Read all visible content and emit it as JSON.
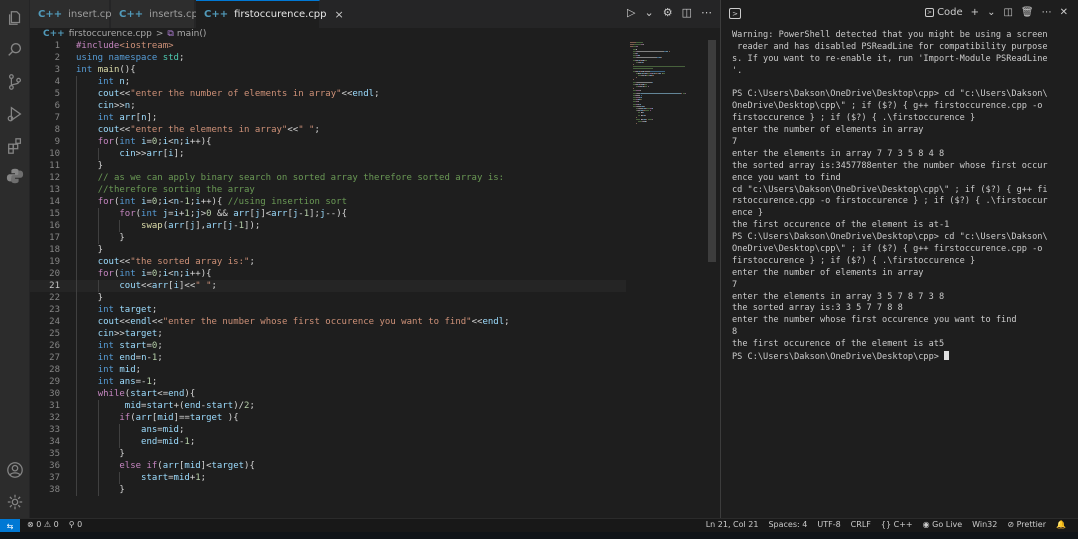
{
  "tabs": [
    {
      "label": "insert.cpp",
      "icon": "C++"
    },
    {
      "label": "inserts.cpp",
      "icon": "C++"
    },
    {
      "label": "firstoccurence.cpp",
      "icon": "C++",
      "active": true,
      "close": "×"
    }
  ],
  "breadcrumb": {
    "file": "firstoccurence.cpp",
    "separator": ">",
    "symbol": "main()"
  },
  "editor": {
    "current_line": 21,
    "lines": [
      [
        [
          "pp",
          "#include"
        ],
        [
          "st",
          "<iostream>"
        ]
      ],
      [
        [
          "kw",
          "using "
        ],
        [
          "kw",
          "namespace "
        ],
        [
          "ns",
          "std"
        ],
        [
          "op",
          ";"
        ]
      ],
      [
        [
          "kw",
          "int "
        ],
        [
          "fn",
          "main"
        ],
        [
          "op",
          "(){"
        ]
      ],
      [
        [
          "op",
          "    "
        ],
        [
          "kw",
          "int "
        ],
        [
          "vr",
          "n"
        ],
        [
          "op",
          ";"
        ]
      ],
      [
        [
          "op",
          "    "
        ],
        [
          "vr",
          "cout"
        ],
        [
          "op",
          "<<"
        ],
        [
          "st",
          "\"enter the number of elements in array\""
        ],
        [
          "op",
          "<<"
        ],
        [
          "vr",
          "endl"
        ],
        [
          "op",
          ";"
        ]
      ],
      [
        [
          "op",
          "    "
        ],
        [
          "vr",
          "cin"
        ],
        [
          "op",
          ">>"
        ],
        [
          "vr",
          "n"
        ],
        [
          "op",
          ";"
        ]
      ],
      [
        [
          "op",
          "    "
        ],
        [
          "kw",
          "int "
        ],
        [
          "vr",
          "arr"
        ],
        [
          "op",
          "["
        ],
        [
          "vr",
          "n"
        ],
        [
          "op",
          "];"
        ]
      ],
      [
        [
          "op",
          "    "
        ],
        [
          "vr",
          "cout"
        ],
        [
          "op",
          "<<"
        ],
        [
          "st",
          "\"enter the elements in array\""
        ],
        [
          "op",
          "<<"
        ],
        [
          "st",
          "\" \""
        ],
        [
          "op",
          ";"
        ]
      ],
      [
        [
          "op",
          "    "
        ],
        [
          "kc",
          "for"
        ],
        [
          "op",
          "("
        ],
        [
          "kw",
          "int "
        ],
        [
          "vr",
          "i"
        ],
        [
          "op",
          "="
        ],
        [
          "nm",
          "0"
        ],
        [
          "op",
          ";"
        ],
        [
          "vr",
          "i"
        ],
        [
          "op",
          "<"
        ],
        [
          "vr",
          "n"
        ],
        [
          "op",
          ";"
        ],
        [
          "vr",
          "i"
        ],
        [
          "op",
          "++){"
        ]
      ],
      [
        [
          "op",
          "        "
        ],
        [
          "vr",
          "cin"
        ],
        [
          "op",
          ">>"
        ],
        [
          "vr",
          "arr"
        ],
        [
          "op",
          "["
        ],
        [
          "vr",
          "i"
        ],
        [
          "op",
          "];"
        ]
      ],
      [
        [
          "op",
          "    }"
        ]
      ],
      [
        [
          "op",
          "    "
        ],
        [
          "cm",
          "// as we can apply binary search on sorted array therefore sorted array is:"
        ]
      ],
      [
        [
          "op",
          "    "
        ],
        [
          "cm",
          "//therefore sorting the array"
        ]
      ],
      [
        [
          "op",
          "    "
        ],
        [
          "kc",
          "for"
        ],
        [
          "op",
          "("
        ],
        [
          "kw",
          "int "
        ],
        [
          "vr",
          "i"
        ],
        [
          "op",
          "="
        ],
        [
          "nm",
          "0"
        ],
        [
          "op",
          ";"
        ],
        [
          "vr",
          "i"
        ],
        [
          "op",
          "<"
        ],
        [
          "vr",
          "n"
        ],
        [
          "op",
          "-"
        ],
        [
          "nm",
          "1"
        ],
        [
          "op",
          ";"
        ],
        [
          "vr",
          "i"
        ],
        [
          "op",
          "++){ "
        ],
        [
          "cm",
          "//using insertion sort"
        ]
      ],
      [
        [
          "op",
          "        "
        ],
        [
          "kc",
          "for"
        ],
        [
          "op",
          "("
        ],
        [
          "kw",
          "int "
        ],
        [
          "vr",
          "j"
        ],
        [
          "op",
          "="
        ],
        [
          "vr",
          "i"
        ],
        [
          "op",
          "+"
        ],
        [
          "nm",
          "1"
        ],
        [
          "op",
          ";"
        ],
        [
          "vr",
          "j"
        ],
        [
          "op",
          ">"
        ],
        [
          "nm",
          "0"
        ],
        [
          "op",
          " && "
        ],
        [
          "vr",
          "arr"
        ],
        [
          "op",
          "["
        ],
        [
          "vr",
          "j"
        ],
        [
          "op",
          "]<"
        ],
        [
          "vr",
          "arr"
        ],
        [
          "op",
          "["
        ],
        [
          "vr",
          "j"
        ],
        [
          "op",
          "-"
        ],
        [
          "nm",
          "1"
        ],
        [
          "op",
          "];"
        ],
        [
          "vr",
          "j"
        ],
        [
          "op",
          "--){"
        ]
      ],
      [
        [
          "op",
          "            "
        ],
        [
          "fn",
          "swap"
        ],
        [
          "op",
          "("
        ],
        [
          "vr",
          "arr"
        ],
        [
          "op",
          "["
        ],
        [
          "vr",
          "j"
        ],
        [
          "op",
          "],"
        ],
        [
          "vr",
          "arr"
        ],
        [
          "op",
          "["
        ],
        [
          "vr",
          "j"
        ],
        [
          "op",
          "-"
        ],
        [
          "nm",
          "1"
        ],
        [
          "op",
          "]);"
        ]
      ],
      [
        [
          "op",
          "        }"
        ]
      ],
      [
        [
          "op",
          "    }"
        ]
      ],
      [
        [
          "op",
          "    "
        ],
        [
          "vr",
          "cout"
        ],
        [
          "op",
          "<<"
        ],
        [
          "st",
          "\"the sorted array is:\""
        ],
        [
          "op",
          ";"
        ]
      ],
      [
        [
          "op",
          "    "
        ],
        [
          "kc",
          "for"
        ],
        [
          "op",
          "("
        ],
        [
          "kw",
          "int "
        ],
        [
          "vr",
          "i"
        ],
        [
          "op",
          "="
        ],
        [
          "nm",
          "0"
        ],
        [
          "op",
          ";"
        ],
        [
          "vr",
          "i"
        ],
        [
          "op",
          "<"
        ],
        [
          "vr",
          "n"
        ],
        [
          "op",
          ";"
        ],
        [
          "vr",
          "i"
        ],
        [
          "op",
          "++){"
        ]
      ],
      [
        [
          "op",
          "        "
        ],
        [
          "vr",
          "cout"
        ],
        [
          "op",
          "<<"
        ],
        [
          "vr",
          "arr"
        ],
        [
          "op",
          "["
        ],
        [
          "vr",
          "i"
        ],
        [
          "op",
          "]<<"
        ],
        [
          "st",
          "\" \""
        ],
        [
          "op",
          ";"
        ]
      ],
      [
        [
          "op",
          "    }"
        ]
      ],
      [
        [
          "op",
          "    "
        ],
        [
          "kw",
          "int "
        ],
        [
          "vr",
          "target"
        ],
        [
          "op",
          ";"
        ]
      ],
      [
        [
          "op",
          "    "
        ],
        [
          "vr",
          "cout"
        ],
        [
          "op",
          "<<"
        ],
        [
          "vr",
          "endl"
        ],
        [
          "op",
          "<<"
        ],
        [
          "st",
          "\"enter the number whose first occurence you want to find\""
        ],
        [
          "op",
          "<<"
        ],
        [
          "vr",
          "endl"
        ],
        [
          "op",
          ";"
        ]
      ],
      [
        [
          "op",
          "    "
        ],
        [
          "vr",
          "cin"
        ],
        [
          "op",
          ">>"
        ],
        [
          "vr",
          "target"
        ],
        [
          "op",
          ";"
        ]
      ],
      [
        [
          "op",
          "    "
        ],
        [
          "kw",
          "int "
        ],
        [
          "vr",
          "start"
        ],
        [
          "op",
          "="
        ],
        [
          "nm",
          "0"
        ],
        [
          "op",
          ";"
        ]
      ],
      [
        [
          "op",
          "    "
        ],
        [
          "kw",
          "int "
        ],
        [
          "vr",
          "end"
        ],
        [
          "op",
          "="
        ],
        [
          "vr",
          "n"
        ],
        [
          "op",
          "-"
        ],
        [
          "nm",
          "1"
        ],
        [
          "op",
          ";"
        ]
      ],
      [
        [
          "op",
          "    "
        ],
        [
          "kw",
          "int "
        ],
        [
          "vr",
          "mid"
        ],
        [
          "op",
          ";"
        ]
      ],
      [
        [
          "op",
          "    "
        ],
        [
          "kw",
          "int "
        ],
        [
          "vr",
          "ans"
        ],
        [
          "op",
          "=-"
        ],
        [
          "nm",
          "1"
        ],
        [
          "op",
          ";"
        ]
      ],
      [
        [
          "op",
          "    "
        ],
        [
          "kc",
          "while"
        ],
        [
          "op",
          "("
        ],
        [
          "vr",
          "start"
        ],
        [
          "op",
          "<="
        ],
        [
          "vr",
          "end"
        ],
        [
          "op",
          "){"
        ]
      ],
      [
        [
          "op",
          "         "
        ],
        [
          "vr",
          "mid"
        ],
        [
          "op",
          "="
        ],
        [
          "vr",
          "start"
        ],
        [
          "op",
          "+("
        ],
        [
          "vr",
          "end"
        ],
        [
          "op",
          "-"
        ],
        [
          "vr",
          "start"
        ],
        [
          "op",
          ")/"
        ],
        [
          "nm",
          "2"
        ],
        [
          "op",
          ";"
        ]
      ],
      [
        [
          "op",
          "        "
        ],
        [
          "kc",
          "if"
        ],
        [
          "op",
          "("
        ],
        [
          "vr",
          "arr"
        ],
        [
          "op",
          "["
        ],
        [
          "vr",
          "mid"
        ],
        [
          "op",
          "]=="
        ],
        [
          "vr",
          "target"
        ],
        [
          "op",
          " ){"
        ]
      ],
      [
        [
          "op",
          "            "
        ],
        [
          "vr",
          "ans"
        ],
        [
          "op",
          "="
        ],
        [
          "vr",
          "mid"
        ],
        [
          "op",
          ";"
        ]
      ],
      [
        [
          "op",
          "            "
        ],
        [
          "vr",
          "end"
        ],
        [
          "op",
          "="
        ],
        [
          "vr",
          "mid"
        ],
        [
          "op",
          "-"
        ],
        [
          "nm",
          "1"
        ],
        [
          "op",
          ";"
        ]
      ],
      [
        [
          "op",
          "        }"
        ]
      ],
      [
        [
          "op",
          "        "
        ],
        [
          "kc",
          "else if"
        ],
        [
          "op",
          "("
        ],
        [
          "vr",
          "arr"
        ],
        [
          "op",
          "["
        ],
        [
          "vr",
          "mid"
        ],
        [
          "op",
          "]<"
        ],
        [
          "vr",
          "target"
        ],
        [
          "op",
          "){"
        ]
      ],
      [
        [
          "op",
          "            "
        ],
        [
          "vr",
          "start"
        ],
        [
          "op",
          "="
        ],
        [
          "vr",
          "mid"
        ],
        [
          "op",
          "+"
        ],
        [
          "nm",
          "1"
        ],
        [
          "op",
          ";"
        ]
      ],
      [
        [
          "op",
          "        }"
        ]
      ]
    ]
  },
  "terminal": {
    "header_label": "Code",
    "lines": [
      "Warning: PowerShell detected that you might be using a screen",
      " reader and has disabled PSReadLine for compatibility purpose",
      "s. If you want to re-enable it, run 'Import-Module PSReadLine",
      "'.",
      "",
      "PS C:\\Users\\Dakson\\OneDrive\\Desktop\\cpp> cd \"c:\\Users\\Dakson\\",
      "OneDrive\\Desktop\\cpp\\\" ; if ($?) { g++ firstoccurence.cpp -o",
      "firstoccurence } ; if ($?) { .\\firstoccurence }",
      "enter the number of elements in array",
      "7",
      "enter the elements in array 7 7 3 5 8 4 8",
      "the sorted array is:3457788enter the number whose first occur",
      "ence you want to find",
      "cd \"c:\\Users\\Dakson\\OneDrive\\Desktop\\cpp\\\" ; if ($?) { g++ fi",
      "rstoccurence.cpp -o firstoccurence } ; if ($?) { .\\firstoccur",
      "ence }",
      "the first occurence of the element is at-1",
      "PS C:\\Users\\Dakson\\OneDrive\\Desktop\\cpp> cd \"c:\\Users\\Dakson\\",
      "OneDrive\\Desktop\\cpp\\\" ; if ($?) { g++ firstoccurence.cpp -o",
      "firstoccurence } ; if ($?) { .\\firstoccurence }",
      "enter the number of elements in array",
      "7",
      "enter the elements in array 3 5 7 8 7 3 8",
      "the sorted array is:3 3 5 7 7 8 8",
      "enter the number whose first occurence you want to find",
      "8",
      "the first occurence of the element is at5"
    ],
    "prompt": "PS C:\\Users\\Dakson\\OneDrive\\Desktop\\cpp> "
  },
  "status": {
    "errors": "0",
    "warnings": "0",
    "ports": "0",
    "position": "Ln 21, Col 21",
    "spaces": "Spaces: 4",
    "encoding": "UTF-8",
    "eol": "CRLF",
    "language": "C++",
    "golive": "Go Live",
    "platform": "Win32",
    "prettier": "Prettier"
  },
  "icons": [
    "explorer-icon",
    "search-icon",
    "source-control-icon",
    "run-debug-icon",
    "extensions-icon",
    "python-icon",
    "account-icon",
    "settings-gear-icon"
  ],
  "colors": {
    "accent": "#0078d4",
    "editor_bg": "#1e1e1e",
    "sidebar_bg": "#2c2c2c"
  }
}
